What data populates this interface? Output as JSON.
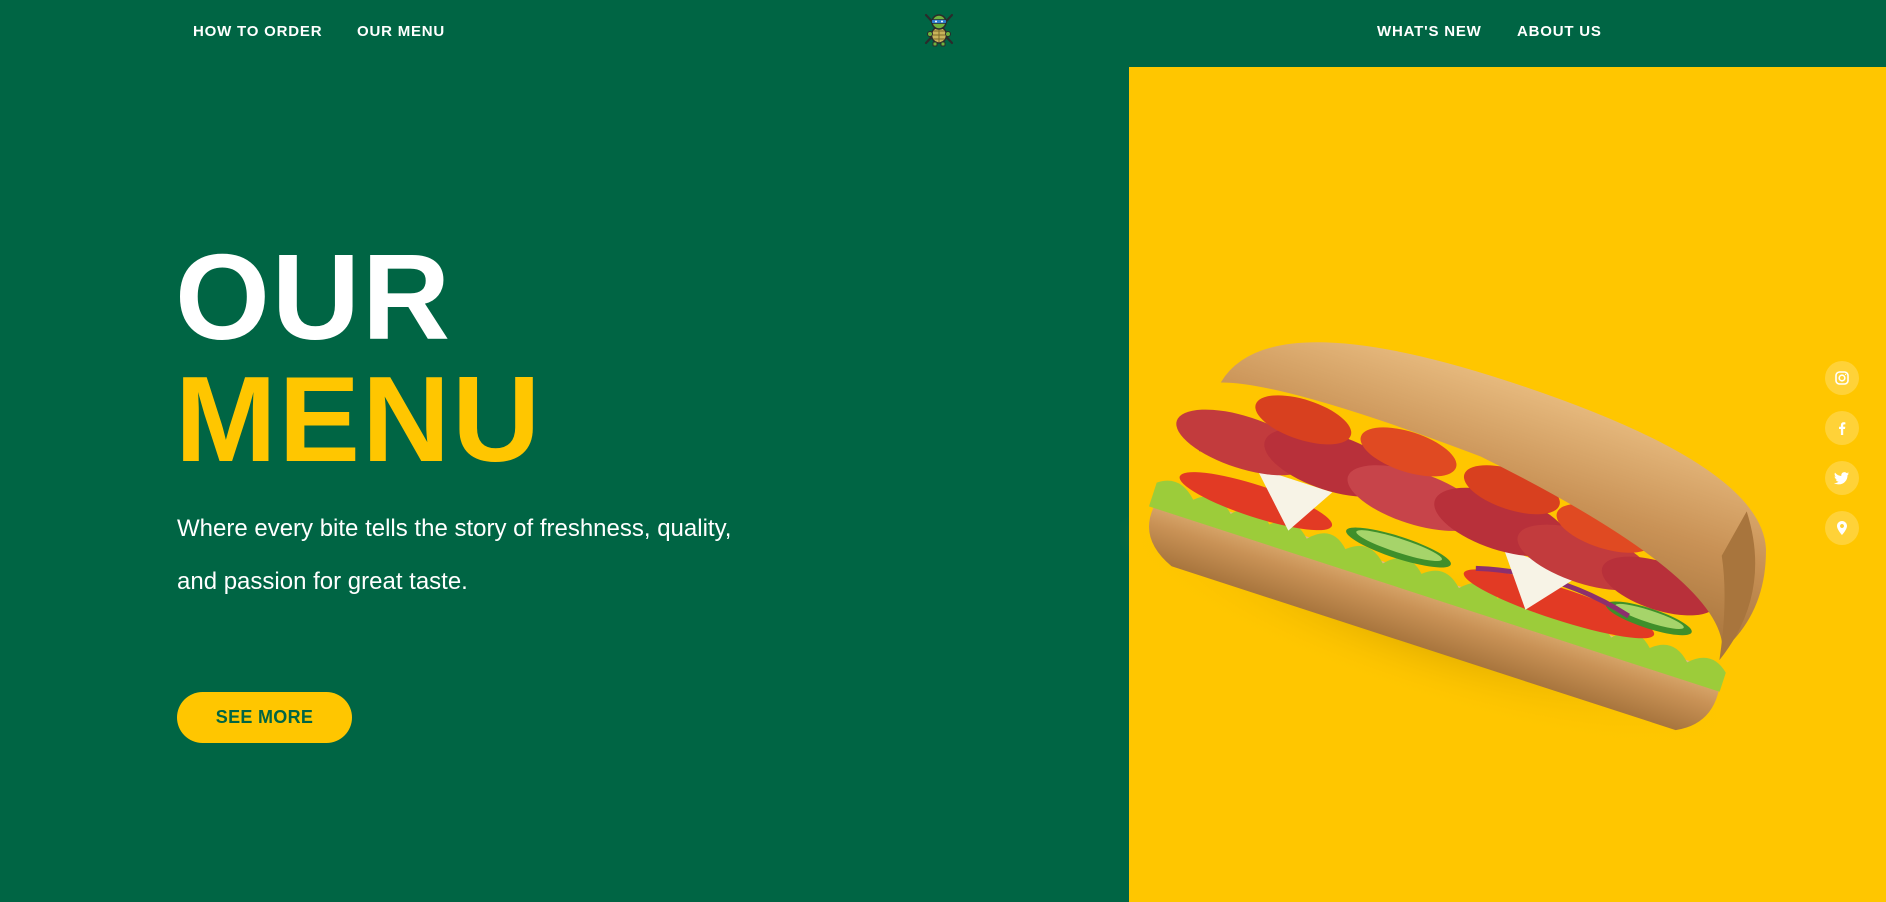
{
  "nav": {
    "left": [
      "HOW TO ORDER",
      "OUR MENU"
    ],
    "right": [
      "WHAT'S NEW",
      "ABOUT US"
    ],
    "logo_icon": "ninja-turtle-logo-icon"
  },
  "hero": {
    "title_line1": "OUR",
    "title_line2": "MENU",
    "tagline": "Where every bite tells the story of freshness, quality, and passion for great taste.",
    "cta_label": "SEE MORE",
    "image_icon": "sub-sandwich-image"
  },
  "social": {
    "icons": [
      "instagram-icon",
      "facebook-icon",
      "twitter-icon",
      "location-pin-icon"
    ]
  },
  "colors": {
    "brand_green": "#006544",
    "accent_yellow": "#ffc600",
    "text_white": "#ffffff"
  }
}
